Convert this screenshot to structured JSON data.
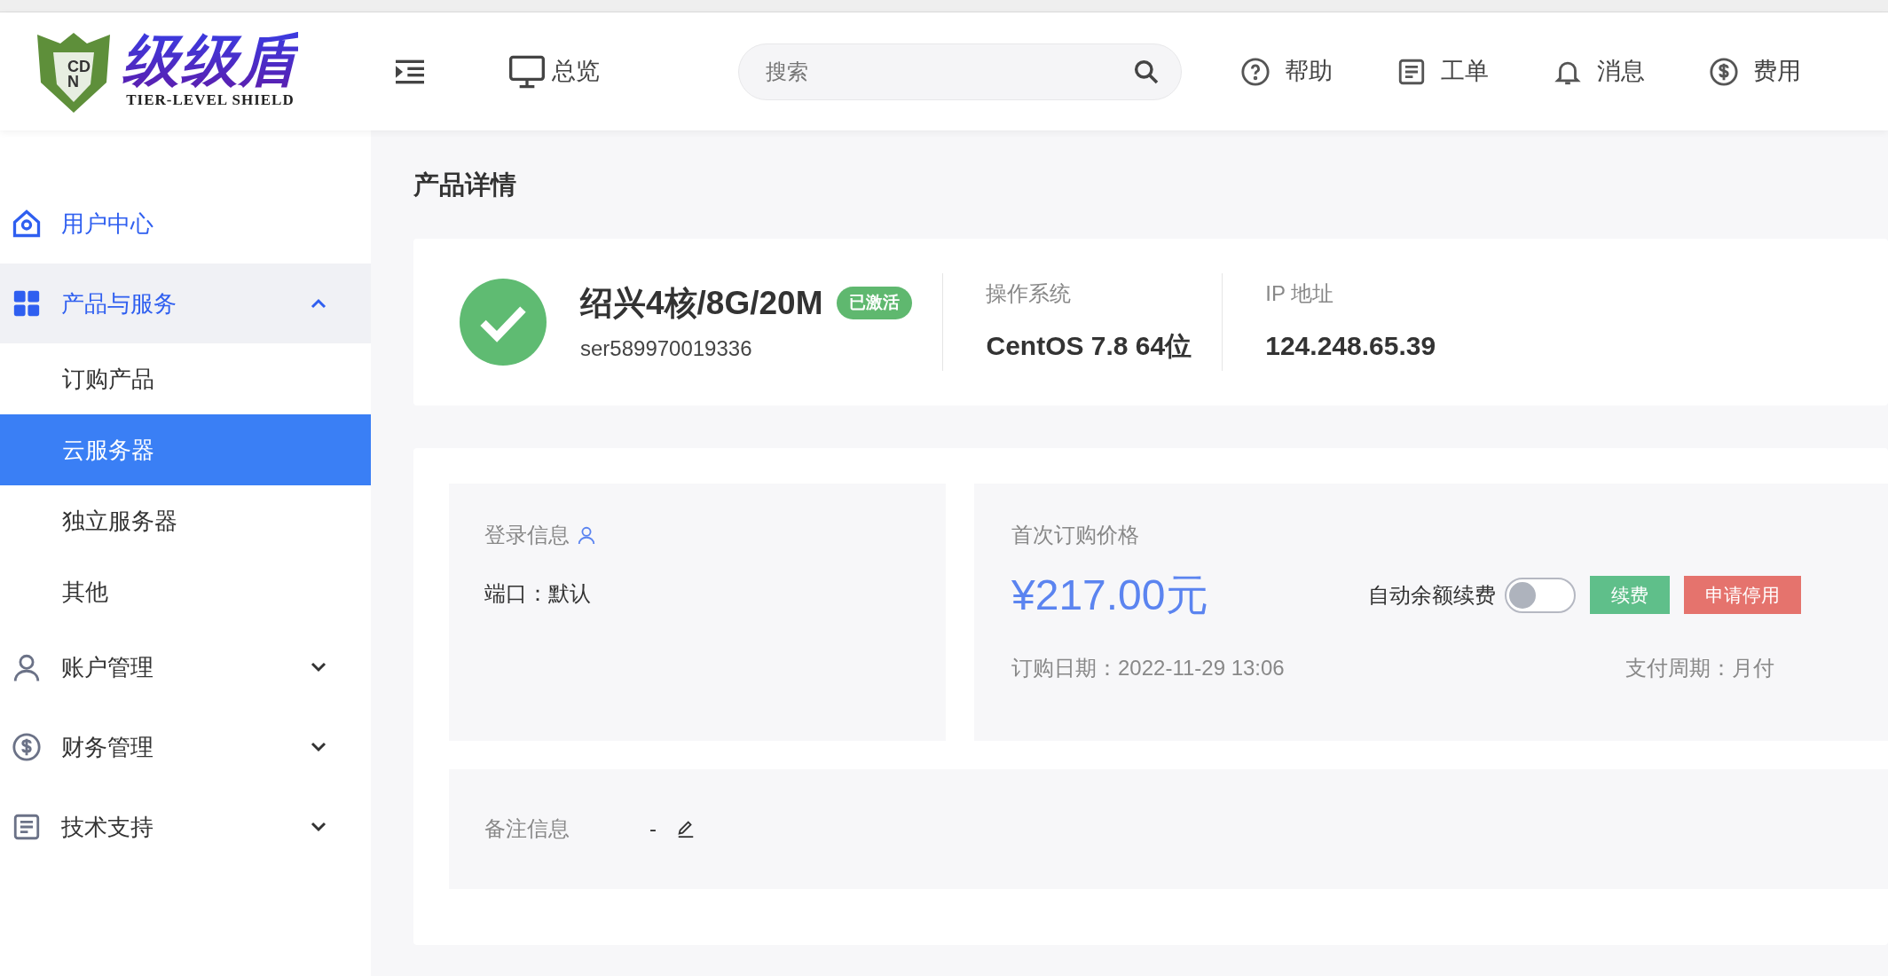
{
  "logo": {
    "badge": "CDN",
    "title": "级级盾",
    "subtitle": "TIER-LEVEL SHIELD"
  },
  "header": {
    "overview": "总览",
    "search": {
      "placeholder": "搜索"
    },
    "links": [
      {
        "kind": "help",
        "label": "帮助"
      },
      {
        "kind": "ticket",
        "label": "工单"
      },
      {
        "kind": "bell",
        "label": "消息"
      },
      {
        "kind": "fee",
        "label": "费用"
      }
    ]
  },
  "sidebar": {
    "items": [
      {
        "kind": "home",
        "label": "用户中心",
        "active": true
      },
      {
        "kind": "grid",
        "label": "产品与服务",
        "active": true,
        "expanded": true,
        "children": [
          {
            "label": "订购产品",
            "selected": false
          },
          {
            "label": "云服务器",
            "selected": true
          },
          {
            "label": "独立服务器",
            "selected": false
          },
          {
            "label": "其他",
            "selected": false
          }
        ]
      },
      {
        "kind": "user",
        "label": "账户管理",
        "active": false,
        "expanded": false
      },
      {
        "kind": "fee",
        "label": "财务管理",
        "active": false,
        "expanded": false
      },
      {
        "kind": "doc",
        "label": "技术支持",
        "active": false,
        "expanded": false
      }
    ]
  },
  "page_title": "产品详情",
  "product": {
    "name": "绍兴4核/8G/20M",
    "status": "已激活",
    "id": "ser589970019336",
    "facts": [
      {
        "label": "操作系统",
        "value": "CentOS 7.8 64位"
      },
      {
        "label": "IP 地址",
        "value": "124.248.65.39"
      }
    ]
  },
  "login": {
    "title": "登录信息",
    "port": "端口：默认"
  },
  "price": {
    "title": "首次订购价格",
    "amount": "¥217.00元",
    "auto_renew": {
      "label": "自动余额续费",
      "on": false
    },
    "buttons": [
      {
        "kind": "success",
        "label": "续费"
      },
      {
        "kind": "danger",
        "label": "申请停用"
      }
    ],
    "order_date": "订购日期：2022-11-29 13:06",
    "cycle": "支付周期：月付"
  },
  "remark": {
    "label": "备注信息",
    "value": "-"
  }
}
